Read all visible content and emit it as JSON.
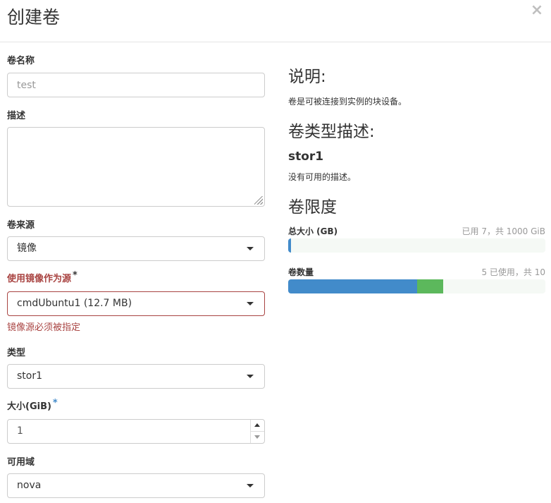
{
  "modal": {
    "title": "创建卷",
    "close_label": "×"
  },
  "form": {
    "volume_name": {
      "label": "卷名称",
      "placeholder": "test",
      "value": ""
    },
    "description": {
      "label": "描述",
      "value": ""
    },
    "volume_source": {
      "label": "卷来源",
      "selected": "镜像"
    },
    "image_source": {
      "label": "使用镜像作为源",
      "required_mark": "*",
      "selected": "cmdUbuntu1 (12.7 MB)",
      "error": "镜像源必须被指定"
    },
    "type": {
      "label": "类型",
      "selected": "stor1"
    },
    "size": {
      "label": "大小(GiB)",
      "required_mark": "*",
      "value": "1"
    },
    "availability_zone": {
      "label": "可用域",
      "selected": "nova"
    }
  },
  "info": {
    "description_heading": "说明:",
    "description_text": "卷是可被连接到实例的块设备。",
    "type_heading": "卷类型描述:",
    "type_name": "stor1",
    "type_description": "没有可用的描述。",
    "limits_heading": "卷限度"
  },
  "quotas": {
    "total_size": {
      "label": "总大小 (GB)",
      "usage_text": "已用 7，共 1000 GiB",
      "used": 7,
      "limit": 1000,
      "color": "#428bca"
    },
    "volume_count": {
      "label": "卷数量",
      "usage_text": "5 已使用，共 10",
      "used": 5,
      "adding": 1,
      "limit": 10,
      "used_color": "#428bca",
      "adding_color": "#5cb85c"
    }
  }
}
